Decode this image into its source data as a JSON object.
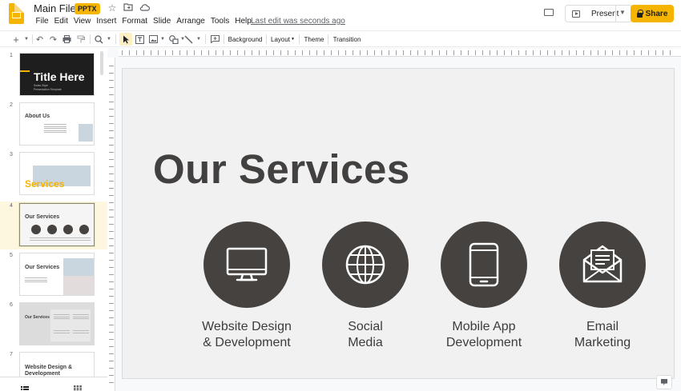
{
  "header": {
    "doc_title": "Main File",
    "file_badge": "PPTX",
    "menus": [
      "File",
      "Edit",
      "View",
      "Insert",
      "Format",
      "Slide",
      "Arrange",
      "Tools",
      "Help"
    ],
    "last_edit": "Last edit was seconds ago",
    "present_label": "Present",
    "share_label": "Share"
  },
  "toolbar": {
    "background_label": "Background",
    "layout_label": "Layout",
    "theme_label": "Theme",
    "transition_label": "Transition"
  },
  "filmstrip": {
    "slides": [
      {
        "num": "1",
        "title": "Title Here",
        "subtitle_1": "Swiss Style",
        "subtitle_2": "Presentation Template"
      },
      {
        "num": "2",
        "title": "About Us"
      },
      {
        "num": "3",
        "title": "Services"
      },
      {
        "num": "4",
        "title": "Our Services"
      },
      {
        "num": "5",
        "title": "Our Services"
      },
      {
        "num": "6",
        "title": "Our Services"
      },
      {
        "num": "7",
        "title": "Website Design & Development"
      }
    ],
    "selected_index": 4
  },
  "slide": {
    "heading": "Our Services",
    "services": [
      {
        "icon": "monitor-icon",
        "line1": "Website Design",
        "line2": "& Development"
      },
      {
        "icon": "globe-icon",
        "line1": "Social",
        "line2": "Media"
      },
      {
        "icon": "mobile-phone-icon",
        "line1": "Mobile App",
        "line2": "Development"
      },
      {
        "icon": "email-envelope-icon",
        "line1": "Email",
        "line2": "Marketing"
      }
    ]
  },
  "colors": {
    "accent": "#f4b400",
    "service_circle": "#454240",
    "heading": "#434040",
    "slide_bg": "#f1f1f1"
  }
}
